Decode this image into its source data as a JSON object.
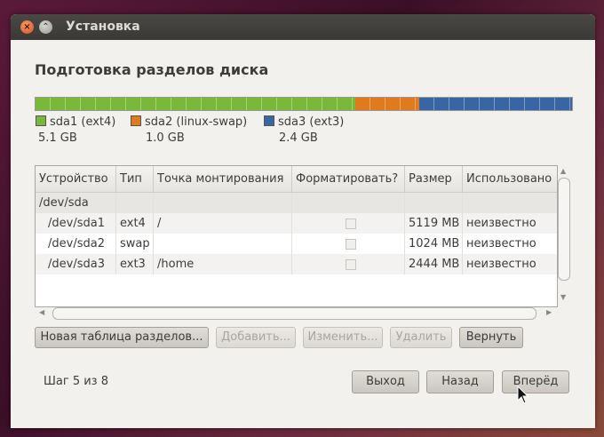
{
  "window": {
    "title": "Установка"
  },
  "heading": "Подготовка разделов диска",
  "partitions": [
    {
      "name": "sda1 (ext4)",
      "size": "5.1 GB",
      "color": "#7ab83a",
      "fraction": 0.596
    },
    {
      "name": "sda2 (linux-swap)",
      "size": "1.0 GB",
      "color": "#e07a1f",
      "fraction": 0.119
    },
    {
      "name": "sda3 (ext3)",
      "size": "2.4 GB",
      "color": "#3a65a5",
      "fraction": 0.285
    }
  ],
  "table": {
    "columns": [
      "Устройство",
      "Тип",
      "Точка монтирования",
      "Форматировать?",
      "Размер",
      "Использовано"
    ],
    "group": "/dev/sda",
    "rows": [
      {
        "device": "/dev/sda1",
        "type": "ext4",
        "mount": "/",
        "format": true,
        "size": "5119 MB",
        "used": "неизвестно"
      },
      {
        "device": "/dev/sda2",
        "type": "swap",
        "mount": "",
        "format": false,
        "size": "1024 MB",
        "used": "неизвестно"
      },
      {
        "device": "/dev/sda3",
        "type": "ext3",
        "mount": "/home",
        "format": true,
        "size": "2444 MB",
        "used": "неизвестно"
      }
    ]
  },
  "actions": {
    "new_table": "Новая таблица разделов...",
    "add": "Добавить...",
    "change": "Изменить...",
    "delete": "Удалить",
    "revert": "Вернуть"
  },
  "footer": {
    "step": "Шаг 5 из 8",
    "quit": "Выход",
    "back": "Назад",
    "forward": "Вперёд"
  }
}
